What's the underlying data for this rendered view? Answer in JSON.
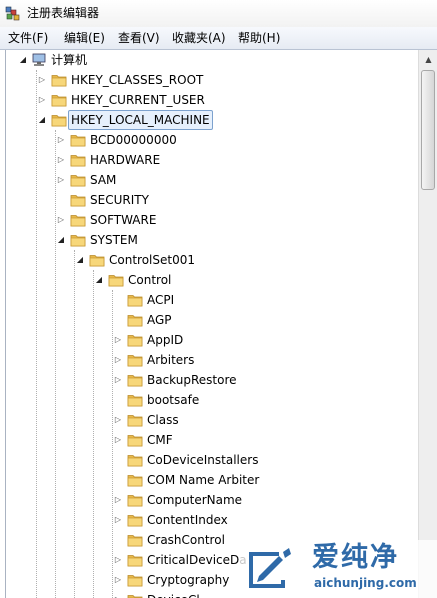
{
  "window": {
    "title": "注册表编辑器",
    "icon": "regedit-icon"
  },
  "menu": [
    {
      "label": "文件(F)"
    },
    {
      "label": "编辑(E)"
    },
    {
      "label": "查看(V)"
    },
    {
      "label": "收藏夹(A)"
    },
    {
      "label": "帮助(H)"
    }
  ],
  "tree": {
    "root": {
      "label": "计算机",
      "icon": "computer-icon",
      "expanded": true
    },
    "hkey_classes_root": {
      "label": "HKEY_CLASSES_ROOT",
      "expanded": false
    },
    "hkey_current_user": {
      "label": "HKEY_CURRENT_USER",
      "expanded": false
    },
    "hkey_local_machine": {
      "label": "HKEY_LOCAL_MACHINE",
      "expanded": true,
      "selected": true
    },
    "hklm_children": [
      {
        "label": "BCD00000000",
        "has_children": true
      },
      {
        "label": "HARDWARE",
        "has_children": true
      },
      {
        "label": "SAM",
        "has_children": true
      },
      {
        "label": "SECURITY",
        "has_children": false
      },
      {
        "label": "SOFTWARE",
        "has_children": true
      },
      {
        "label": "SYSTEM",
        "has_children": true,
        "expanded": true
      }
    ],
    "controlset001": {
      "label": "ControlSet001",
      "expanded": true
    },
    "control": {
      "label": "Control",
      "expanded": true
    },
    "control_children": [
      {
        "label": "ACPI",
        "has_children": false
      },
      {
        "label": "AGP",
        "has_children": false
      },
      {
        "label": "AppID",
        "has_children": true
      },
      {
        "label": "Arbiters",
        "has_children": true
      },
      {
        "label": "BackupRestore",
        "has_children": true
      },
      {
        "label": "bootsafe",
        "has_children": false
      },
      {
        "label": "Class",
        "has_children": true
      },
      {
        "label": "CMF",
        "has_children": true
      },
      {
        "label": "CoDeviceInstallers",
        "has_children": false
      },
      {
        "label": "COM Name Arbiter",
        "has_children": false
      },
      {
        "label": "ComputerName",
        "has_children": true
      },
      {
        "label": "ContentIndex",
        "has_children": true
      },
      {
        "label": "CrashControl",
        "has_children": false
      },
      {
        "label": "CriticalDeviceDa",
        "has_children": true
      },
      {
        "label": "Cryptography",
        "has_children": true
      },
      {
        "label": "DeviceCl",
        "has_children": true
      }
    ]
  },
  "watermark": {
    "title": "爱纯净",
    "url": "aichunjing.com"
  },
  "colors": {
    "folder": "#f3cf6a",
    "selection": "#e6f0fc",
    "watermark": "#2f6aa8"
  }
}
